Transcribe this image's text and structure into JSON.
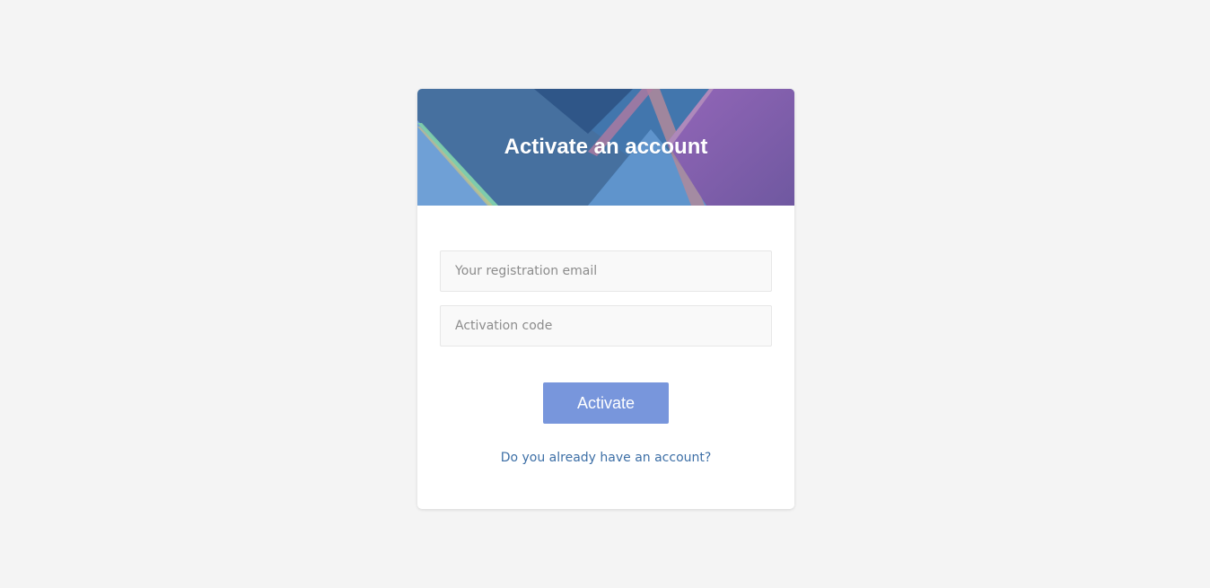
{
  "header": {
    "title": "Activate an account"
  },
  "form": {
    "email_placeholder": "Your registration email",
    "email_value": "",
    "code_placeholder": "Activation code",
    "code_value": "",
    "submit_label": "Activate"
  },
  "links": {
    "login_label": "Do you already have an account?"
  },
  "colors": {
    "page_background": "#f4f4f4",
    "button": "#7896dc",
    "link": "#3d6fa6",
    "banner_blue": "#4670a3",
    "banner_purple": "#8a5fb0"
  }
}
